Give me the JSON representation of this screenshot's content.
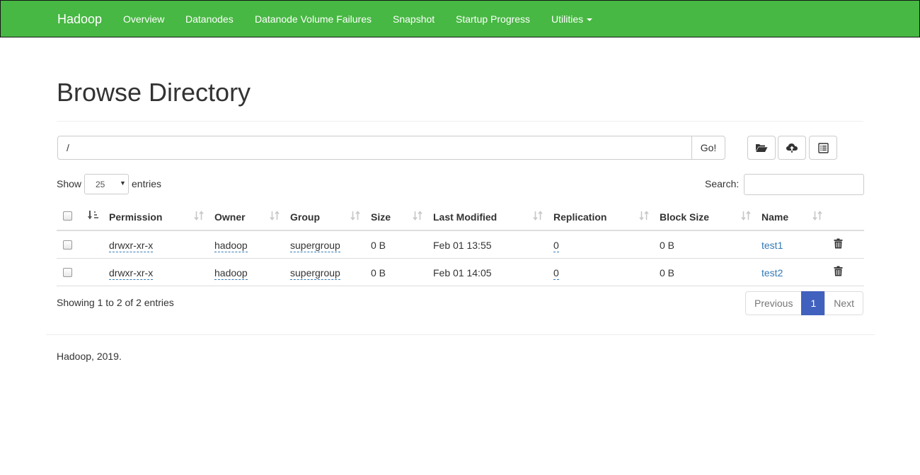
{
  "navbar": {
    "brand": "Hadoop",
    "items": [
      {
        "label": "Overview"
      },
      {
        "label": "Datanodes"
      },
      {
        "label": "Datanode Volume Failures"
      },
      {
        "label": "Snapshot"
      },
      {
        "label": "Startup Progress"
      },
      {
        "label": "Utilities"
      }
    ],
    "background_color": "#47b843"
  },
  "page": {
    "title": "Browse Directory"
  },
  "path_bar": {
    "value": "/",
    "go_label": "Go!",
    "icons": [
      "folder-open-icon",
      "cloud-upload-icon",
      "list-alt-icon"
    ]
  },
  "table_controls": {
    "show_label": "Show",
    "entries_label": "entries",
    "page_length": "25",
    "search_label": "Search:",
    "search_value": ""
  },
  "table": {
    "columns": [
      "Permission",
      "Owner",
      "Group",
      "Size",
      "Last Modified",
      "Replication",
      "Block Size",
      "Name"
    ],
    "rows": [
      {
        "permission": "drwxr-xr-x",
        "owner": "hadoop",
        "group": "supergroup",
        "size": "0 B",
        "last_modified": "Feb 01 13:55",
        "replication": "0",
        "block_size": "0 B",
        "name": "test1"
      },
      {
        "permission": "drwxr-xr-x",
        "owner": "hadoop",
        "group": "supergroup",
        "size": "0 B",
        "last_modified": "Feb 01 14:05",
        "replication": "0",
        "block_size": "0 B",
        "name": "test2"
      }
    ]
  },
  "pagination": {
    "info": "Showing 1 to 2 of 2 entries",
    "previous": "Previous",
    "current": "1",
    "next": "Next",
    "active_color": "#4161be"
  },
  "footer": {
    "text": "Hadoop, 2019."
  }
}
